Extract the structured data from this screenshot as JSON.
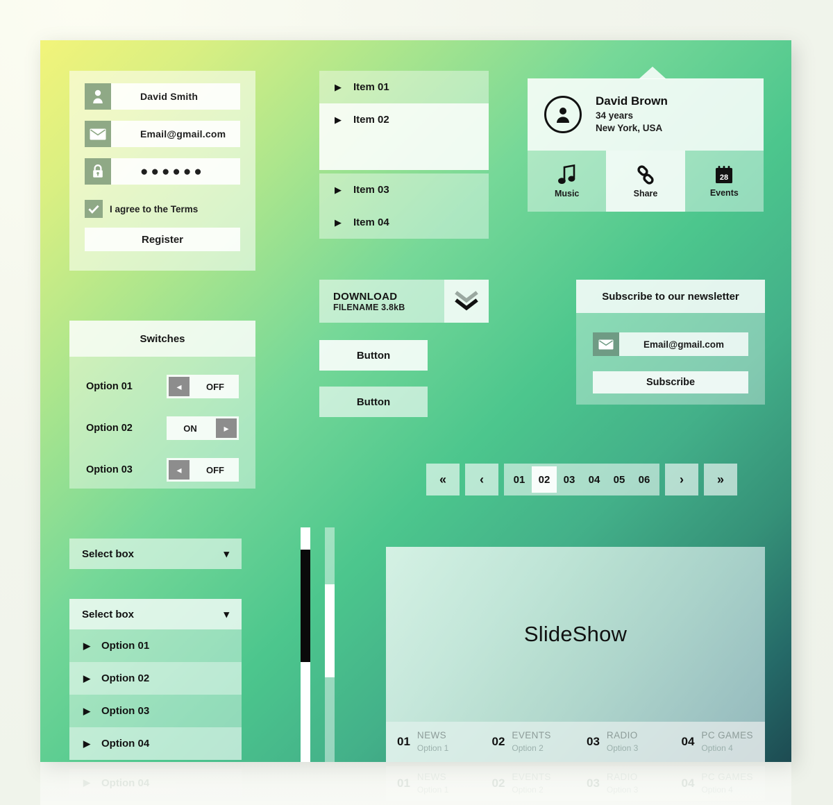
{
  "theme": {
    "gradient_start": "#f2f47a",
    "gradient_mid": "#4cc68d",
    "gradient_end": "#1d4b52",
    "page_background": "#f2f5ec",
    "icon_tile": "#8fa986",
    "toggle_knob": "#8d8d8d"
  },
  "register": {
    "name_value": "David Smith",
    "name_icon": "user-icon",
    "email_value": "Email@gmail.com",
    "email_icon": "envelope-icon",
    "password_value": "●●●●●●",
    "password_icon": "lock-icon",
    "terms_label": "I agree to the Terms",
    "checkbox_icon": "check-icon",
    "submit_label": "Register"
  },
  "accordion": {
    "items": [
      {
        "label": "Item 01",
        "expanded": false
      },
      {
        "label": "Item 02",
        "expanded": true
      },
      {
        "label": "Item 03",
        "expanded": false
      },
      {
        "label": "Item 04",
        "expanded": false
      }
    ]
  },
  "profile": {
    "avatar_icon": "person-icon",
    "name": "David Brown",
    "age": "34 years",
    "location": "New York, USA",
    "actions": [
      {
        "label": "Music",
        "icon": "music-note-icon",
        "active": false
      },
      {
        "label": "Share",
        "icon": "link-chain-icon",
        "active": true
      },
      {
        "label": "Events",
        "icon": "calendar-icon",
        "calendar_day": "28",
        "active": false
      }
    ]
  },
  "download": {
    "title": "DOWNLOAD",
    "subtitle": "FILENAME 3.8kB",
    "icon": "double-chevron-down-icon"
  },
  "buttons": {
    "primary_label": "Button",
    "secondary_label": "Button"
  },
  "switches": {
    "title": "Switches",
    "rows": [
      {
        "label": "Option 01",
        "state": "OFF",
        "on": false
      },
      {
        "label": "Option 02",
        "state": "ON",
        "on": true
      },
      {
        "label": "Option 03",
        "state": "OFF",
        "on": false
      }
    ]
  },
  "newsletter": {
    "title": "Subscribe to our newsletter",
    "email_icon": "envelope-icon",
    "email_value": "Email@gmail.com",
    "submit_label": "Subscribe"
  },
  "pagination": {
    "first_label": "«",
    "prev_label": "‹",
    "next_label": "›",
    "last_label": "»",
    "pages": [
      "01",
      "02",
      "03",
      "04",
      "05",
      "06"
    ],
    "active_page": "02"
  },
  "select_closed": {
    "label": "Select box",
    "caret_icon": "chevron-down-icon"
  },
  "select_open": {
    "label": "Select box",
    "caret_icon": "chevron-down-icon",
    "options": [
      "Option 01",
      "Option 02",
      "Option 03",
      "Option 04"
    ]
  },
  "scrollbars": [
    {
      "name": "scrollbar-dark",
      "thumb_color": "#0a0a0a",
      "track_color": "#ffffff"
    },
    {
      "name": "scrollbar-light",
      "thumb_color": "#ffffff",
      "track_color": "rgba(255,255,255,0.45)"
    }
  ],
  "slideshow": {
    "title": "SlideShow",
    "tabs": [
      {
        "num": "01",
        "title": "NEWS",
        "subtitle": "Option 1"
      },
      {
        "num": "02",
        "title": "EVENTS",
        "subtitle": "Option 2"
      },
      {
        "num": "03",
        "title": "RADIO",
        "subtitle": "Option 3"
      },
      {
        "num": "04",
        "title": "PC GAMES",
        "subtitle": "Option 4"
      }
    ]
  }
}
